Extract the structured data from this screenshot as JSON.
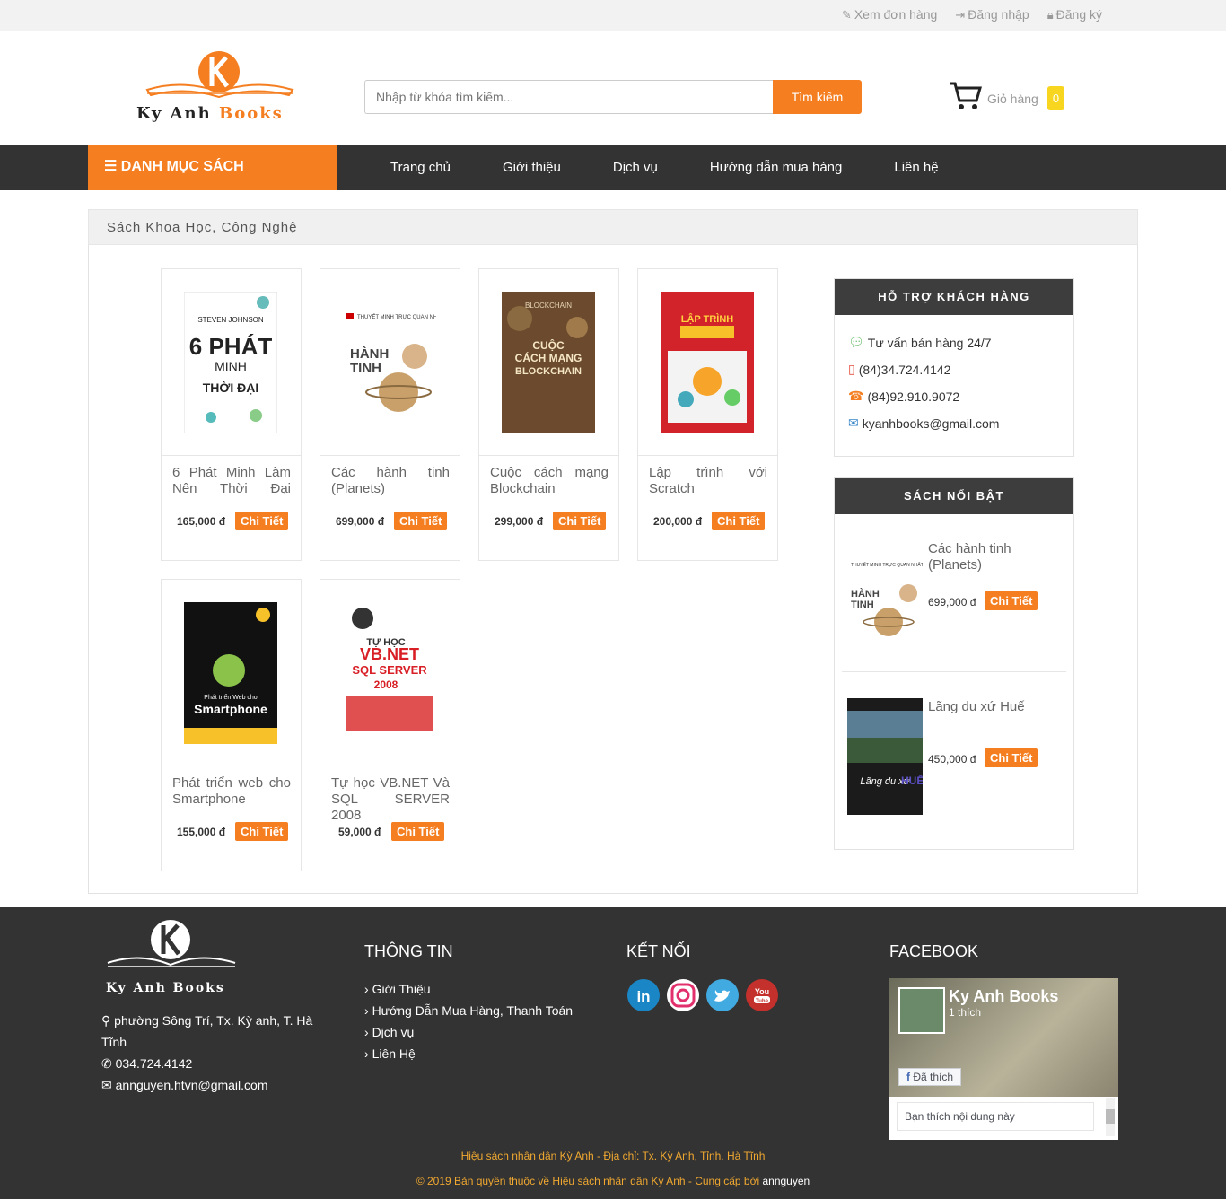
{
  "topbar": {
    "view_orders": "Xem đơn hàng",
    "login": "Đăng nhập",
    "register": "Đăng ký"
  },
  "brand": {
    "name_part1": "Ky Anh",
    "name_part2": "Books"
  },
  "search": {
    "placeholder": "Nhập từ khóa tìm kiếm...",
    "button": "Tìm kiếm"
  },
  "cart": {
    "label": "Giỏ hàng",
    "count": "0"
  },
  "nav": {
    "category_button": "DANH MỤC SÁCH",
    "items": [
      "Trang chủ",
      "Giới thiệu",
      "Dịch vụ",
      "Hướng dẫn mua hàng",
      "Liên hệ"
    ]
  },
  "breadcrumb": "Sách Khoa Học, Công Nghệ",
  "products": [
    {
      "title": "6 Phát Minh Làm Nên Thời Đại",
      "price": "165,000 đ",
      "button": "Chi Tiết"
    },
    {
      "title": "Các hành tinh (Planets)",
      "price": "699,000 đ",
      "button": "Chi Tiết"
    },
    {
      "title": "Cuộc cách mạng Blockchain",
      "price": "299,000 đ",
      "button": "Chi Tiết"
    },
    {
      "title": "Lập trình với Scratch",
      "price": "200,000 đ",
      "button": "Chi Tiết"
    },
    {
      "title": "Phát triển web cho Smartphone",
      "price": "155,000 đ",
      "button": "Chi Tiết"
    },
    {
      "title": "Tự học VB.NET Và SQL SERVER 2008",
      "price": "59,000 đ",
      "button": "Chi Tiết"
    }
  ],
  "support": {
    "heading": "HỖ TRỢ KHÁCH HÀNG",
    "items": [
      "Tư vấn bán hàng 24/7",
      "(84)34.724.4142",
      "(84)92.910.9072",
      "kyanhbooks@gmail.com"
    ]
  },
  "featured": {
    "heading": "SÁCH NỔI BẬT",
    "items": [
      {
        "title": "Các hành tinh (Planets)",
        "price": "699,000 đ",
        "button": "Chi Tiết"
      },
      {
        "title": "Lãng du xứ Huế",
        "price": "450,000 đ",
        "button": "Chi Tiết"
      }
    ]
  },
  "footer": {
    "address": "phường Sông Trí, Tx. Kỳ anh, T. Hà Tĩnh",
    "phone": "034.724.4142",
    "email": "annguyen.htvn@gmail.com",
    "info_heading": "THÔNG TIN",
    "info_links": [
      "Giới Thiệu",
      "Hướng Dẫn Mua Hàng, Thanh Toán",
      "Dịch vụ",
      "Liên Hệ"
    ],
    "connect_heading": "KẾT NỐI",
    "facebook_heading": "FACEBOOK",
    "fb_page_name": "Ky Anh Books",
    "fb_likes": "1 thích",
    "fb_liked_button": "Đã thích",
    "fb_comment": "Bạn thích nội dung này",
    "copy_line1": "Hiệu sách nhân dân Kỳ Anh - Địa chỉ: Tx. Kỳ Anh, Tỉnh. Hà Tĩnh",
    "copy_line2": "© 2019 Bản quyền thuộc về Hiệu sách nhân dân Kỳ Anh - Cung cấp bởi",
    "copy_author": "annguyen"
  },
  "colors": {
    "accent": "#f47e20",
    "dark": "#333333",
    "cart_badge": "#f8d51e"
  }
}
